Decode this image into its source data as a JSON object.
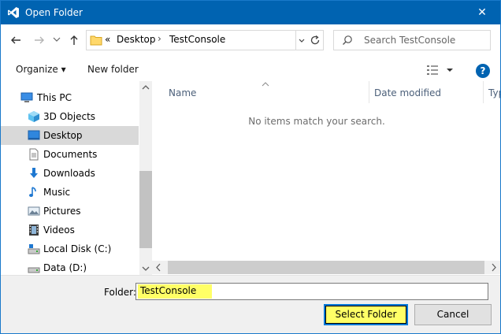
{
  "window": {
    "title": "Open Folder",
    "close_glyph": "✕",
    "accent_color": "#0063b1"
  },
  "nav": {
    "back_icon": "arrow-left-icon",
    "forward_icon": "arrow-right-icon",
    "recent_icon": "chevron-down-icon",
    "up_icon": "arrow-up-icon"
  },
  "address": {
    "overflow": "«",
    "crumbs": [
      "Desktop",
      "TestConsole"
    ],
    "separator": "›"
  },
  "search": {
    "placeholder": "Search TestConsole"
  },
  "toolbar": {
    "organize_label": "Organize ▾",
    "new_folder_label": "New folder",
    "help_label": "?"
  },
  "sidebar": {
    "items": [
      {
        "label": "This PC",
        "icon": "computer-icon"
      },
      {
        "label": "3D Objects",
        "icon": "cube-icon"
      },
      {
        "label": "Desktop",
        "icon": "desktop-icon",
        "selected": true
      },
      {
        "label": "Documents",
        "icon": "documents-icon"
      },
      {
        "label": "Downloads",
        "icon": "download-icon"
      },
      {
        "label": "Music",
        "icon": "music-icon"
      },
      {
        "label": "Pictures",
        "icon": "pictures-icon"
      },
      {
        "label": "Videos",
        "icon": "videos-icon"
      },
      {
        "label": "Local Disk (C:)",
        "icon": "drive-icon"
      },
      {
        "label": "Data (D:)",
        "icon": "drive-icon"
      }
    ]
  },
  "content": {
    "columns": [
      "Name",
      "Date modified",
      "Typ"
    ],
    "empty_message": "No items match your search."
  },
  "footer": {
    "folder_label": "Folder:",
    "folder_value": "TestConsole",
    "select_label": "Select Folder",
    "cancel_label": "Cancel",
    "highlight_color": "#ffff66"
  }
}
